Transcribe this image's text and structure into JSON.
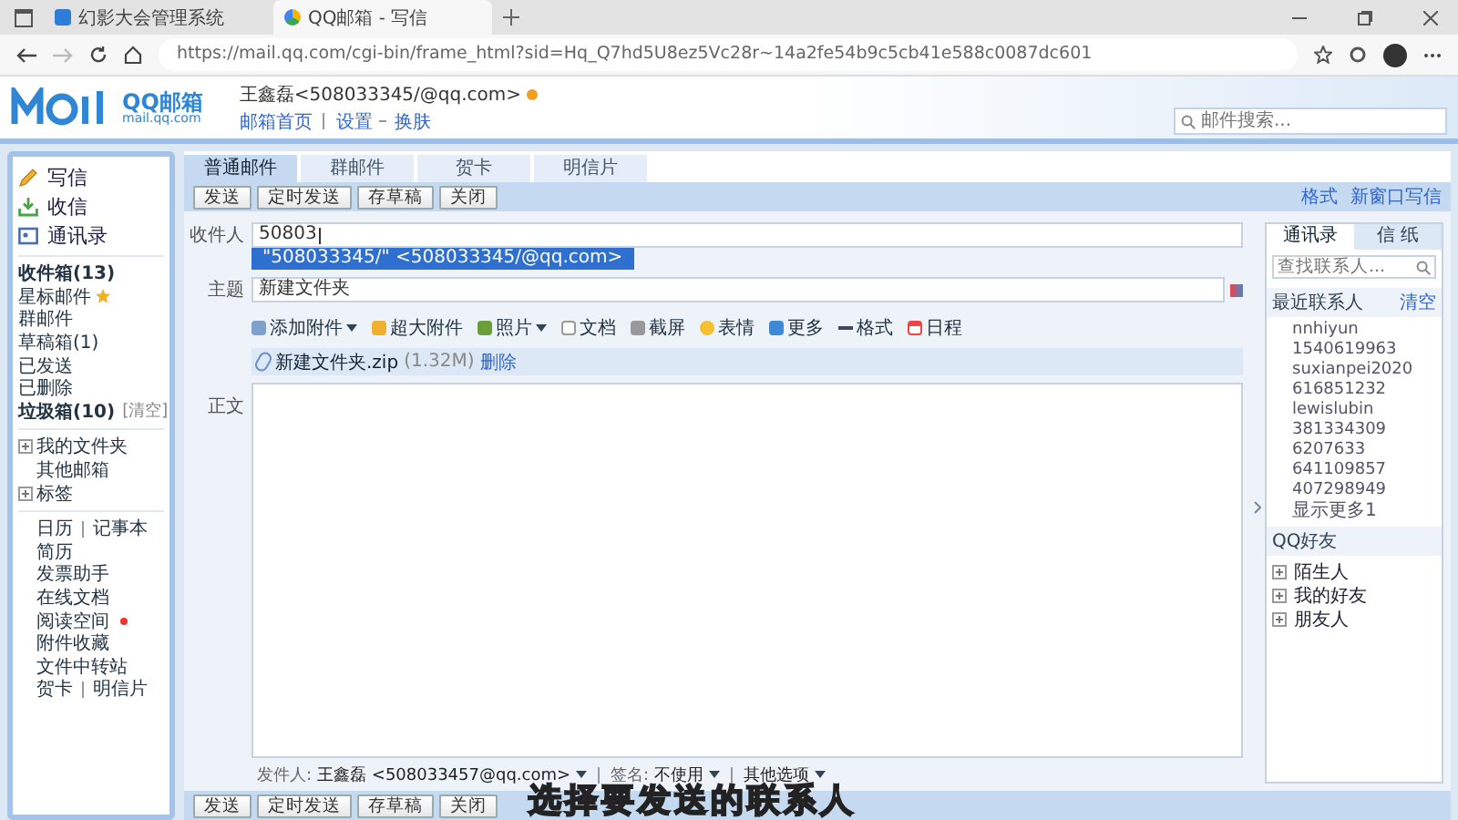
{
  "browser": {
    "tabs": [
      {
        "title": "幻影大会管理系统",
        "selected": false
      },
      {
        "title": "QQ邮箱 - 写信",
        "selected": true
      }
    ],
    "url": "https://mail.qq.com/cgi-bin/frame_html?sid=Hq_Q7hd5U8ez5Vc28r~14a2fe54b9c5cb41e588c0087dc601"
  },
  "header": {
    "logo": "QQ邮箱",
    "logo_sub": "mail.qq.com",
    "user": "王鑫磊<508033345/@qq.com>",
    "links": [
      "邮箱首页",
      "设置",
      "换肤"
    ],
    "search_placeholder": "邮件搜索..."
  },
  "sidebar": {
    "actions": [
      {
        "label": "写信",
        "kind": "write"
      },
      {
        "label": "收信",
        "kind": "inbox"
      },
      {
        "label": "通讯录",
        "kind": "contacts"
      }
    ],
    "folders": [
      {
        "label": "收件箱(13)",
        "bold": true,
        "starred": false
      },
      {
        "label": "星标邮件",
        "bold": false,
        "starred": true
      },
      {
        "label": "群邮件",
        "bold": false,
        "starred": false
      },
      {
        "label": "草稿箱(1)",
        "bold": false,
        "starred": false
      },
      {
        "label": "已发送",
        "bold": false,
        "starred": false
      },
      {
        "label": "已删除",
        "bold": false,
        "starred": false
      },
      {
        "label": "垃圾箱(10)",
        "bold": true,
        "starred": false,
        "action": "[清空]"
      }
    ],
    "groups": [
      {
        "label": "我的文件夹",
        "kind": "tree"
      },
      {
        "label": "其他邮箱",
        "kind": "plain"
      },
      {
        "label": "标签",
        "kind": "tree"
      }
    ],
    "apps": [
      {
        "label": "日历",
        "second": "记事本",
        "dot": false
      },
      {
        "label": "简历",
        "dot": false
      },
      {
        "label": "发票助手",
        "dot": false
      },
      {
        "label": "在线文档",
        "dot": false
      },
      {
        "label": "阅读空间",
        "dot": true
      },
      {
        "label": "附件收藏",
        "dot": false
      },
      {
        "label": "文件中转站",
        "dot": false
      },
      {
        "label": "贺卡",
        "second": "明信片",
        "dot": false
      }
    ]
  },
  "compose": {
    "tabs": [
      {
        "label": "普通邮件",
        "selected": true
      },
      {
        "label": "群邮件",
        "selected": false
      },
      {
        "label": "贺卡",
        "selected": false
      },
      {
        "label": "明信片",
        "selected": false
      }
    ],
    "buttons": [
      "发送",
      "定时发送",
      "存草稿",
      "关闭"
    ],
    "links": [
      "格式",
      "新窗口写信"
    ],
    "to_label": "收件人",
    "to_value": "50803",
    "suggestion": "\"508033345/\" <508033345/@qq.com>",
    "subject_label": "主题",
    "subject_value": "新建文件夹",
    "toolbar": [
      {
        "label": "添加附件",
        "kind": "clip",
        "dropdown": true
      },
      {
        "label": "超大附件",
        "kind": "bigclip",
        "dropdown": false
      },
      {
        "label": "照片",
        "kind": "photo",
        "dropdown": true
      },
      {
        "label": "文档",
        "kind": "doc",
        "dropdown": false
      },
      {
        "label": "截屏",
        "kind": "cut",
        "dropdown": false
      },
      {
        "label": "表情",
        "kind": "smile",
        "dropdown": false
      },
      {
        "label": "更多",
        "kind": "more",
        "dropdown": false
      },
      {
        "label": "格式",
        "kind": "font",
        "dropdown": false
      },
      {
        "label": "日程",
        "kind": "calendar",
        "dropdown": false
      }
    ],
    "attachment": {
      "name": "新建文件夹.zip",
      "size": "(1.32M)",
      "action": "删除"
    },
    "body_label": "正文",
    "footer": [
      {
        "label": "发件人:",
        "value": "王鑫磊 <508033457@qq.com>"
      },
      {
        "label": "签名:",
        "value": "不使用"
      },
      {
        "value": "其他选项"
      }
    ],
    "bottom_buttons": [
      "发送",
      "定时发送",
      "存草稿",
      "关闭"
    ]
  },
  "contacts": {
    "tabs": [
      {
        "label": "通讯录",
        "selected": true
      },
      {
        "label": "信 纸",
        "selected": false
      }
    ],
    "search_placeholder": "查找联系人...",
    "recent_title": "最近联系人",
    "clear": "清空",
    "recent": [
      "nnhiyun",
      "1540619963",
      "suxianpei2020",
      "616851232",
      "lewislubin",
      "381334309",
      "6207633",
      "641109857",
      "407298949"
    ],
    "more": "显示更多1",
    "qq_title": "QQ好友",
    "groups": [
      "陌生人",
      "我的好友",
      "朋友人"
    ]
  },
  "subtitle": "选择要发送的联系人"
}
